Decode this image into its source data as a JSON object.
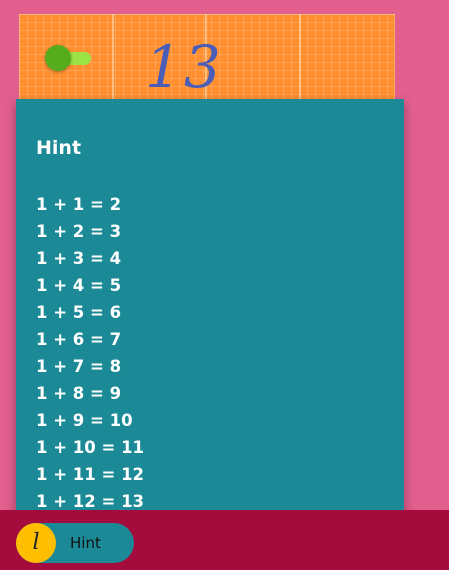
{
  "board": {
    "answer": "13",
    "toggle_on": true,
    "colors": {
      "board": "#ff8f2f",
      "toggle_knob": "#55ad1e",
      "toggle_track": "#9ce446",
      "answer": "#4a5eb7"
    }
  },
  "hint_panel": {
    "title": "Hint",
    "items": [
      "1 + 1 = 2",
      "1 + 2 = 3",
      "1 + 3 = 4",
      "1 + 4 = 5",
      "1 + 5 = 6",
      "1 + 6 = 7",
      "1 + 7 = 8",
      "1 + 8 = 9",
      "1 + 9 = 10",
      "1 + 10 = 11",
      "1 + 11 = 12",
      "1 + 12 = 13"
    ],
    "color": "#1b8996"
  },
  "bottom_bar": {
    "hint_button": {
      "badge": "l",
      "label": "Hint"
    },
    "color": "#a30c3c"
  }
}
